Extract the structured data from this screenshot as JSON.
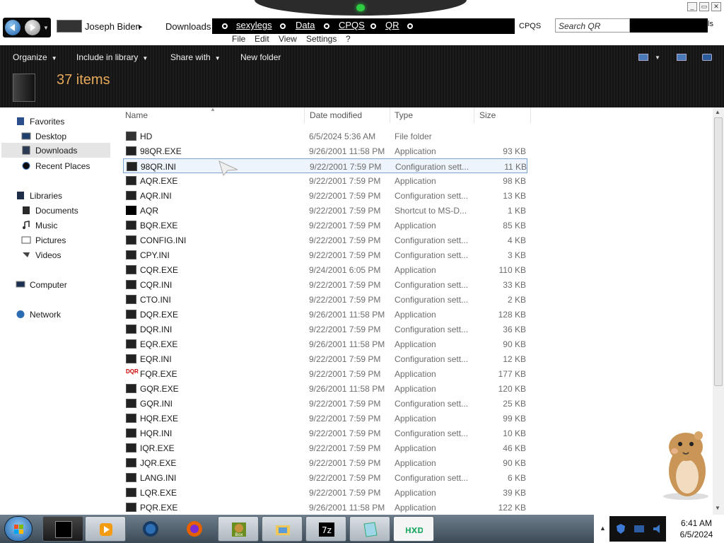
{
  "window": {
    "controls": [
      "minimize",
      "maximize",
      "close"
    ]
  },
  "address": {
    "user": "Joseph Biden",
    "folder": "Downloads",
    "menu_links": [
      "sexylegs",
      "Data",
      "CPQS",
      "QR"
    ],
    "cp_chip": "CPQS",
    "search_placeholder": "Search QR",
    "search_tail": "ls"
  },
  "menubar": [
    "File",
    "Edit",
    "View",
    "Settings",
    "?"
  ],
  "toolbar": {
    "organize": "Organize",
    "include_in_library": "Include in library",
    "share_with": "Share with",
    "new_folder": "New folder"
  },
  "header": {
    "item_count": "37 items"
  },
  "nav": {
    "favorites": "Favorites",
    "desktop": "Desktop",
    "downloads": "Downloads",
    "recent_places": "Recent Places",
    "libraries": "Libraries",
    "documents": "Documents",
    "music": "Music",
    "pictures": "Pictures",
    "videos": "Videos",
    "computer": "Computer",
    "network": "Network"
  },
  "columns": {
    "name": "Name",
    "date": "Date modified",
    "type": "Type",
    "size": "Size"
  },
  "files": [
    {
      "name": "HD",
      "date": "6/5/2024 5:36 AM",
      "type": "File folder",
      "size": "",
      "icon": "folder"
    },
    {
      "name": "98QR.EXE",
      "date": "9/26/2001 11:58 PM",
      "type": "Application",
      "size": "93 KB",
      "icon": "app"
    },
    {
      "name": "98QR.INI",
      "date": "9/22/2001 7:59 PM",
      "type": "Configuration sett...",
      "size": "11 KB",
      "icon": "ini",
      "selected": true
    },
    {
      "name": "AQR.EXE",
      "date": "9/22/2001 7:59 PM",
      "type": "Application",
      "size": "98 KB",
      "icon": "app"
    },
    {
      "name": "AQR.INI",
      "date": "9/22/2001 7:59 PM",
      "type": "Configuration sett...",
      "size": "13 KB",
      "icon": "ini"
    },
    {
      "name": "AQR",
      "date": "9/22/2001 7:59 PM",
      "type": "Shortcut to MS-D...",
      "size": "1 KB",
      "icon": "shortcut"
    },
    {
      "name": "BQR.EXE",
      "date": "9/22/2001 7:59 PM",
      "type": "Application",
      "size": "85 KB",
      "icon": "app"
    },
    {
      "name": "CONFIG.INI",
      "date": "9/22/2001 7:59 PM",
      "type": "Configuration sett...",
      "size": "4 KB",
      "icon": "ini"
    },
    {
      "name": "CPY.INI",
      "date": "9/22/2001 7:59 PM",
      "type": "Configuration sett...",
      "size": "3 KB",
      "icon": "ini"
    },
    {
      "name": "CQR.EXE",
      "date": "9/24/2001 6:05 PM",
      "type": "Application",
      "size": "110 KB",
      "icon": "app"
    },
    {
      "name": "CQR.INI",
      "date": "9/22/2001 7:59 PM",
      "type": "Configuration sett...",
      "size": "33 KB",
      "icon": "ini"
    },
    {
      "name": "CTO.INI",
      "date": "9/22/2001 7:59 PM",
      "type": "Configuration sett...",
      "size": "2 KB",
      "icon": "ini"
    },
    {
      "name": "DQR.EXE",
      "date": "9/26/2001 11:58 PM",
      "type": "Application",
      "size": "128 KB",
      "icon": "app"
    },
    {
      "name": "DQR.INI",
      "date": "9/22/2001 7:59 PM",
      "type": "Configuration sett...",
      "size": "36 KB",
      "icon": "ini"
    },
    {
      "name": "EQR.EXE",
      "date": "9/26/2001 11:58 PM",
      "type": "Application",
      "size": "90 KB",
      "icon": "app"
    },
    {
      "name": "EQR.INI",
      "date": "9/22/2001 7:59 PM",
      "type": "Configuration sett...",
      "size": "12 KB",
      "icon": "ini"
    },
    {
      "name": "FQR.EXE",
      "date": "9/22/2001 7:59 PM",
      "type": "Application",
      "size": "177 KB",
      "icon": "fqr"
    },
    {
      "name": "GQR.EXE",
      "date": "9/26/2001 11:58 PM",
      "type": "Application",
      "size": "120 KB",
      "icon": "app"
    },
    {
      "name": "GQR.INI",
      "date": "9/22/2001 7:59 PM",
      "type": "Configuration sett...",
      "size": "25 KB",
      "icon": "ini"
    },
    {
      "name": "HQR.EXE",
      "date": "9/22/2001 7:59 PM",
      "type": "Application",
      "size": "99 KB",
      "icon": "app"
    },
    {
      "name": "HQR.INI",
      "date": "9/22/2001 7:59 PM",
      "type": "Configuration sett...",
      "size": "10 KB",
      "icon": "ini"
    },
    {
      "name": "IQR.EXE",
      "date": "9/22/2001 7:59 PM",
      "type": "Application",
      "size": "46 KB",
      "icon": "app"
    },
    {
      "name": "JQR.EXE",
      "date": "9/22/2001 7:59 PM",
      "type": "Application",
      "size": "90 KB",
      "icon": "app"
    },
    {
      "name": "LANG.INI",
      "date": "9/22/2001 7:59 PM",
      "type": "Configuration sett...",
      "size": "6 KB",
      "icon": "ini"
    },
    {
      "name": "LQR.EXE",
      "date": "9/22/2001 7:59 PM",
      "type": "Application",
      "size": "39 KB",
      "icon": "app"
    },
    {
      "name": "PQR.EXE",
      "date": "9/26/2001 11:58 PM",
      "type": "Application",
      "size": "122 KB",
      "icon": "app"
    }
  ],
  "fqr_icon_text": "DQR",
  "taskbar": {
    "apps": [
      "explorer-icon",
      "media-player-icon",
      "globe-icon",
      "firefox-icon",
      "dosbox-icon",
      "folder-icon",
      "7zip-icon",
      "notepad-icon",
      "hxd-icon"
    ],
    "dosbox_label": "Box",
    "sevenzip_label": "7z",
    "hxd_label": "HXD",
    "time": "6:41 AM",
    "date": "6/5/2024"
  },
  "colors": {
    "accent_count": "#e7a95a",
    "selection_border": "#7da2ce",
    "toolbar_bg": "#1a1a1a"
  }
}
